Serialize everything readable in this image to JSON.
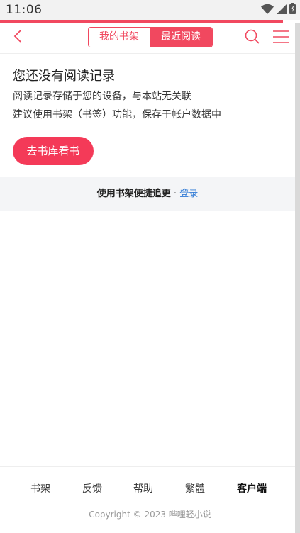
{
  "status_bar": {
    "time": "11:06",
    "icons": [
      "wifi-icon",
      "cell-signal-icon",
      "battery-icon"
    ]
  },
  "colors": {
    "accent": "#f1485f",
    "button": "#f43a58",
    "link": "#2f7ad6"
  },
  "header": {
    "tabs": [
      {
        "label": "我的书架",
        "active": false
      },
      {
        "label": "最近阅读",
        "active": true
      }
    ]
  },
  "empty_state": {
    "title": "您还没有阅读记录",
    "line1": "阅读记录存储于您的设备，与本站无关联",
    "line2": "建议使用书架（书签）功能，保存于帐户数据中",
    "button_label": "去书库看书"
  },
  "tip": {
    "text": "使用书架便捷追更",
    "separator": "·",
    "link": "登录"
  },
  "footer": {
    "links": [
      {
        "label": "书架",
        "bold": false
      },
      {
        "label": "反馈",
        "bold": false
      },
      {
        "label": "帮助",
        "bold": false
      },
      {
        "label": "繁體",
        "bold": false
      },
      {
        "label": "客户端",
        "bold": true
      }
    ],
    "copyright": "Copyright © 2023 哔哩轻小说"
  }
}
